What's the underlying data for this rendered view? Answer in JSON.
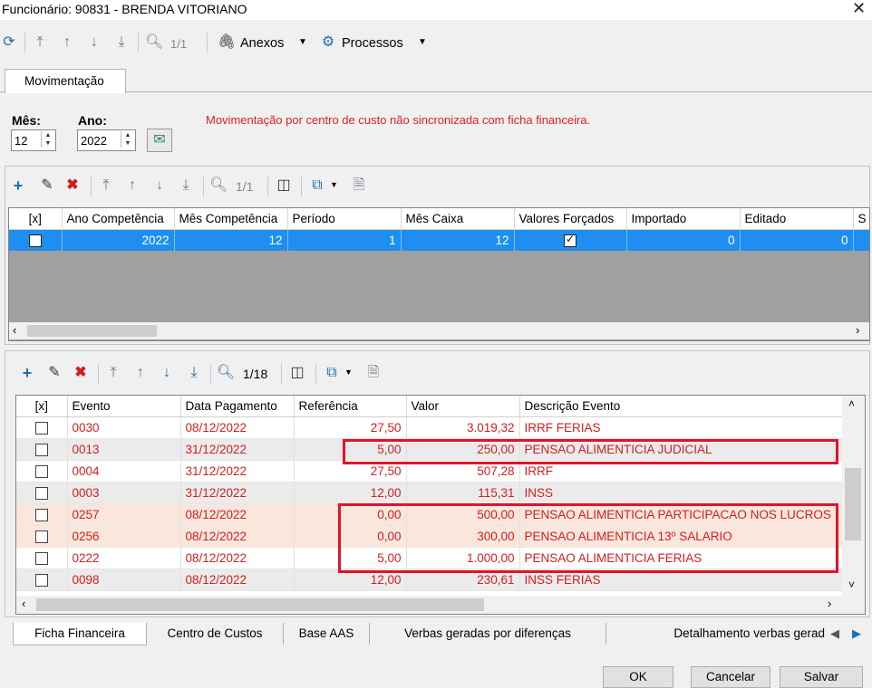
{
  "window": {
    "title": "Funcionário: 90831 - BRENDA VITORIANO",
    "close_glyph": "✕"
  },
  "toolbar": {
    "page_count": "1/1",
    "anexos_label": "Anexos",
    "processos_label": "Processos"
  },
  "tabs": {
    "main": "Movimentação"
  },
  "filters": {
    "mes_label": "Mês:",
    "mes_value": "12",
    "ano_label": "Ano:",
    "ano_value": "2022",
    "warning": "Movimentação por centro de custo não sincronizada com ficha financeira."
  },
  "grid1": {
    "page_count": "1/1",
    "columns": [
      "[x]",
      "Ano Competência",
      "Mês Competência",
      "Período",
      "Mês Caixa",
      "Valores Forçados",
      "Importado",
      "Editado",
      "S"
    ],
    "row": {
      "ano": "2022",
      "mes": "12",
      "periodo": "1",
      "mes_caixa": "12",
      "importado": "0",
      "editado": "0"
    }
  },
  "grid2": {
    "page_count": "1/18",
    "columns": [
      "[x]",
      "Evento",
      "Data Pagamento",
      "Referência",
      "Valor",
      "Descrição Evento"
    ],
    "rows": [
      {
        "evento": "0030",
        "data": "08/12/2022",
        "ref": "27,50",
        "valor": "3.019,32",
        "desc": "IRRF FERIAS"
      },
      {
        "evento": "0013",
        "data": "31/12/2022",
        "ref": "5,00",
        "valor": "250,00",
        "desc": "PENSAO ALIMENTICIA JUDICIAL"
      },
      {
        "evento": "0004",
        "data": "31/12/2022",
        "ref": "27,50",
        "valor": "507,28",
        "desc": "IRRF"
      },
      {
        "evento": "0003",
        "data": "31/12/2022",
        "ref": "12,00",
        "valor": "115,31",
        "desc": "INSS"
      },
      {
        "evento": "0257",
        "data": "08/12/2022",
        "ref": "0,00",
        "valor": "500,00",
        "desc": "PENSAO ALIMENTICIA PARTICIPACAO NOS LUCROS"
      },
      {
        "evento": "0256",
        "data": "08/12/2022",
        "ref": "0,00",
        "valor": "300,00",
        "desc": "PENSAO ALIMENTICIA 13º SALARIO"
      },
      {
        "evento": "0222",
        "data": "08/12/2022",
        "ref": "5,00",
        "valor": "1.000,00",
        "desc": "PENSAO ALIMENTICIA  FERIAS"
      },
      {
        "evento": "0098",
        "data": "08/12/2022",
        "ref": "12,00",
        "valor": "230,61",
        "desc": "INSS FERIAS"
      }
    ]
  },
  "bottom_tabs": [
    "Ficha Financeira",
    "Centro de Custos",
    "Base AAS",
    "Verbas geradas por diferenças",
    "Detalhamento verbas gerad"
  ],
  "buttons": {
    "ok": "OK",
    "cancel": "Cancelar",
    "save": "Salvar"
  },
  "colors": {
    "accent": "#1e8ff0",
    "row_text": "#d02020",
    "highlight_box": "#e0142a"
  }
}
